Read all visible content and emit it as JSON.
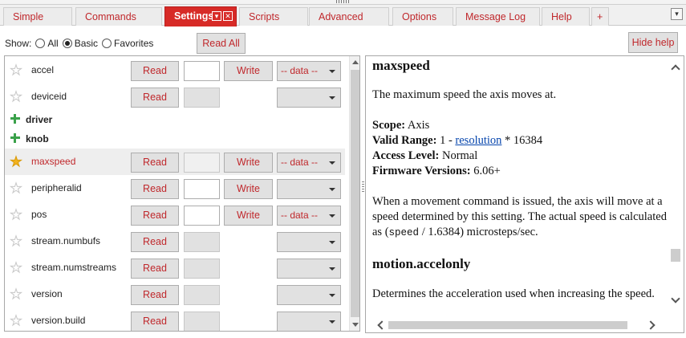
{
  "tabs": [
    {
      "label": "Simple"
    },
    {
      "label": "Commands"
    },
    {
      "label": "Settings",
      "active": true
    },
    {
      "label": "Scripts"
    },
    {
      "label": "Advanced"
    },
    {
      "label": "Options"
    },
    {
      "label": "Message Log"
    },
    {
      "label": "Help"
    },
    {
      "label": "+"
    }
  ],
  "tab_controls": {
    "menu_glyph": "▾",
    "close_glyph": "✕",
    "overflow_glyph": "▾"
  },
  "show_filter": {
    "label": "Show:",
    "options": [
      {
        "label": "All",
        "selected": false
      },
      {
        "label": "Basic",
        "selected": true
      },
      {
        "label": "Favorites",
        "selected": false
      }
    ]
  },
  "read_all_label": "Read All",
  "hide_help_label": "Hide help",
  "settings": [
    {
      "name": "accel",
      "favorite": false,
      "read": "Read",
      "value": "",
      "editable": true,
      "write": "Write",
      "unit": "-- data --"
    },
    {
      "name": "deviceid",
      "favorite": false,
      "read": "Read",
      "value": "",
      "editable": false,
      "write": "",
      "unit": ""
    },
    {
      "group": "driver"
    },
    {
      "group": "knob"
    },
    {
      "name": "maxspeed",
      "favorite": true,
      "selected": true,
      "read": "Read",
      "value": "",
      "editable": false,
      "write": "Write",
      "unit": "-- data --"
    },
    {
      "name": "peripheralid",
      "favorite": false,
      "read": "Read",
      "value": "",
      "editable": true,
      "write": "Write",
      "unit": ""
    },
    {
      "name": "pos",
      "favorite": false,
      "read": "Read",
      "value": "",
      "editable": true,
      "write": "Write",
      "unit": "-- data --"
    },
    {
      "name": "stream.numbufs",
      "favorite": false,
      "read": "Read",
      "value": "",
      "editable": false,
      "write": "",
      "unit": ""
    },
    {
      "name": "stream.numstreams",
      "favorite": false,
      "read": "Read",
      "value": "",
      "editable": false,
      "write": "",
      "unit": ""
    },
    {
      "name": "version",
      "favorite": false,
      "read": "Read",
      "value": "",
      "editable": false,
      "write": "",
      "unit": ""
    },
    {
      "name": "version.build",
      "favorite": false,
      "read": "Read",
      "value": "",
      "editable": false,
      "write": "",
      "unit": ""
    }
  ],
  "help": {
    "title": "maxspeed",
    "description": "The maximum speed the axis moves at.",
    "scope_label": "Scope:",
    "scope_value": "Axis",
    "range_label": "Valid Range:",
    "range_prefix": "1 -",
    "range_link": "resolution",
    "range_suffix": "* 16384",
    "access_label": "Access Level:",
    "access_value": "Normal",
    "firmware_label": "Firmware Versions:",
    "firmware_value": "6.06+",
    "detail_before_code": "When a movement command is issued, the axis will move at a speed determined by this setting. The actual speed is calculated as (",
    "detail_code": "speed",
    "detail_after_code": " / 1.6384) microsteps/sec.",
    "next_title": "motion.accelonly",
    "next_description": "Determines the acceleration used when increasing the speed."
  },
  "colors": {
    "accent": "#d72b27",
    "link_text": "#c0282c",
    "favorite_star": "#f2b21f",
    "group_plus": "#3aa14a"
  }
}
